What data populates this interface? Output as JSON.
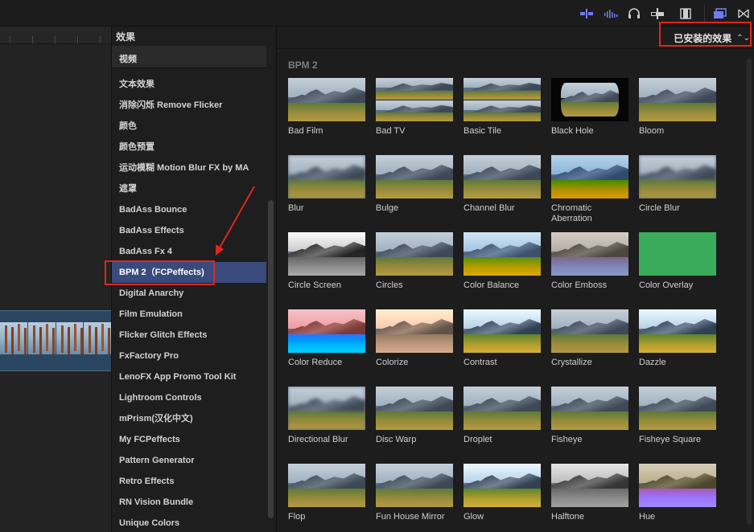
{
  "toolbar": {
    "icons": [
      "audio-skimming-icon",
      "audio-waveform-icon",
      "headphones-icon",
      "snapping-icon",
      "film-strip-icon",
      "browser-toggle-icon",
      "close-panels-icon"
    ]
  },
  "category_panel": {
    "title": "效果",
    "header": "视频",
    "items": [
      "文本效果",
      "消除闪烁 Remove Flicker",
      "颜色",
      "颜色预置",
      "运动模糊 Motion Blur FX by MA",
      "遮罩",
      "BadAss Bounce",
      "BadAss Effects",
      "BadAss Fx 4",
      "BPM 2（FCPeffects)",
      "Digital Anarchy",
      "Film Emulation",
      "Flicker Glitch Effects",
      "FxFactory Pro",
      "LenoFX App Promo Tool Kit",
      "Lightroom Controls",
      "mPrism(汉化中文)",
      "My FCPeffects",
      "Pattern Generator",
      "Retro Effects",
      "RN Vision Bundle",
      "Unique Colors"
    ],
    "selected_index": 9
  },
  "browser": {
    "filter_label": "已安装的效果",
    "group_title": "BPM 2",
    "effects": [
      "Bad Film",
      "Bad TV",
      "Basic Tile",
      "Black Hole",
      "Bloom",
      "Blur",
      "Bulge",
      "Channel Blur",
      "Chromatic Aberration",
      "Circle Blur",
      "Circle Screen",
      "Circles",
      "Color Balance",
      "Color Emboss",
      "Color Overlay",
      "Color Reduce",
      "Colorize",
      "Contrast",
      "Crystallize",
      "Dazzle",
      "Directional Blur",
      "Disc Warp",
      "Droplet",
      "Fisheye",
      "Fisheye Square",
      "Flop",
      "Fun House Mirror",
      "Glow",
      "Halftone",
      "Hue"
    ]
  },
  "colors": {
    "selection": "#3a4a7c",
    "highlight": "#e0251f",
    "color_overlay": "#3aab5a",
    "accent_icon": "#6f7cf0"
  }
}
